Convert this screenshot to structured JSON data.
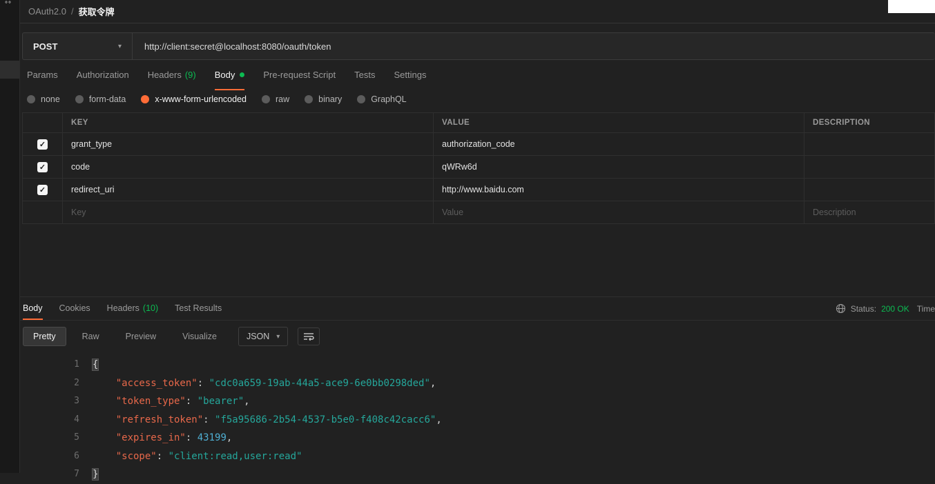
{
  "sidebar": {
    "dots": "°°"
  },
  "breadcrumb": {
    "collection": "OAuth2.0",
    "separator": "/",
    "request": "获取令牌"
  },
  "request": {
    "method": "POST",
    "url": "http://client:secret@localhost:8080/oauth/token"
  },
  "request_tabs": [
    {
      "label": "Params"
    },
    {
      "label": "Authorization"
    },
    {
      "label": "Headers",
      "count": "(9)"
    },
    {
      "label": "Body",
      "active": true,
      "dot": true
    },
    {
      "label": "Pre-request Script"
    },
    {
      "label": "Tests"
    },
    {
      "label": "Settings"
    }
  ],
  "body_types": [
    {
      "label": "none"
    },
    {
      "label": "form-data"
    },
    {
      "label": "x-www-form-urlencoded",
      "selected": true
    },
    {
      "label": "raw"
    },
    {
      "label": "binary"
    },
    {
      "label": "GraphQL"
    }
  ],
  "params_table": {
    "headers": [
      "KEY",
      "VALUE",
      "DESCRIPTION"
    ],
    "rows": [
      {
        "checked": true,
        "key": "grant_type",
        "value": "authorization_code",
        "description": ""
      },
      {
        "checked": true,
        "key": "code",
        "value": "qWRw6d",
        "description": ""
      },
      {
        "checked": true,
        "key": "redirect_uri",
        "value": "http://www.baidu.com",
        "description": ""
      }
    ],
    "placeholder": {
      "key": "Key",
      "value": "Value",
      "description": "Description"
    }
  },
  "response": {
    "tabs": [
      {
        "label": "Body",
        "active": true
      },
      {
        "label": "Cookies"
      },
      {
        "label": "Headers",
        "count": "(10)"
      },
      {
        "label": "Test Results"
      }
    ],
    "meta": {
      "status_label": "Status:",
      "status_value": "200 OK",
      "time_label": "Time"
    },
    "view_tabs": [
      {
        "label": "Pretty",
        "active": true
      },
      {
        "label": "Raw"
      },
      {
        "label": "Preview"
      },
      {
        "label": "Visualize"
      }
    ],
    "format_select": "JSON",
    "code_lines": [
      {
        "n": "1",
        "tokens": [
          [
            "{",
            "brace"
          ]
        ]
      },
      {
        "n": "2",
        "tokens": [
          [
            "    ",
            "plain"
          ],
          [
            "\"access_token\"",
            "key"
          ],
          [
            ": ",
            "plain"
          ],
          [
            "\"cdc0a659-19ab-44a5-ace9-6e0bb0298ded\"",
            "string"
          ],
          [
            ",",
            "plain"
          ]
        ]
      },
      {
        "n": "3",
        "tokens": [
          [
            "    ",
            "plain"
          ],
          [
            "\"token_type\"",
            "key"
          ],
          [
            ": ",
            "plain"
          ],
          [
            "\"bearer\"",
            "string"
          ],
          [
            ",",
            "plain"
          ]
        ]
      },
      {
        "n": "4",
        "tokens": [
          [
            "    ",
            "plain"
          ],
          [
            "\"refresh_token\"",
            "key"
          ],
          [
            ": ",
            "plain"
          ],
          [
            "\"f5a95686-2b54-4537-b5e0-f408c42cacc6\"",
            "string"
          ],
          [
            ",",
            "plain"
          ]
        ]
      },
      {
        "n": "5",
        "tokens": [
          [
            "    ",
            "plain"
          ],
          [
            "\"expires_in\"",
            "key"
          ],
          [
            ": ",
            "plain"
          ],
          [
            "43199",
            "number"
          ],
          [
            ",",
            "plain"
          ]
        ]
      },
      {
        "n": "6",
        "tokens": [
          [
            "    ",
            "plain"
          ],
          [
            "\"scope\"",
            "key"
          ],
          [
            ": ",
            "plain"
          ],
          [
            "\"client:read,user:read\"",
            "string"
          ]
        ]
      },
      {
        "n": "7",
        "tokens": [
          [
            "}",
            "brace"
          ]
        ]
      }
    ]
  },
  "colors": {
    "accent": "#ff6c37",
    "success": "#0cbb52"
  }
}
